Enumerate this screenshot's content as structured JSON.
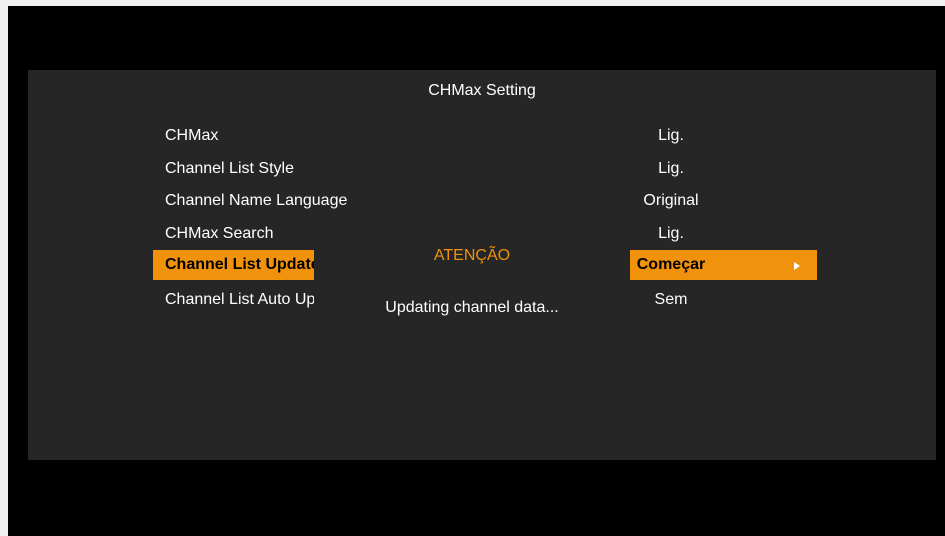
{
  "title": "CHMax Setting",
  "menu": [
    {
      "label": "CHMax",
      "value": "Lig."
    },
    {
      "label": "Channel List Style",
      "value": "Lig."
    },
    {
      "label": "Channel Name Language",
      "value": "Original"
    },
    {
      "label": "CHMax Search",
      "value": "Lig."
    },
    {
      "label": "Channel List Update",
      "value": "Começar",
      "selected": true
    },
    {
      "label": "Channel List Auto Update",
      "value": "Sem"
    }
  ],
  "dialog": {
    "title": "ATENÇÃO",
    "message": "Updating channel data..."
  },
  "colors": {
    "accent": "#f0920c",
    "panel": "#262626",
    "background": "#000000"
  }
}
